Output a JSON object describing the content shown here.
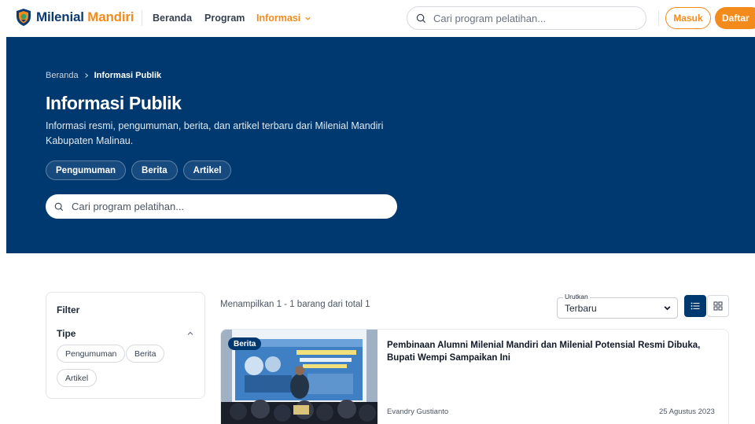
{
  "header": {
    "brand_part1": "Milenial",
    "brand_part2": "Mandiri",
    "nav": [
      {
        "label": "Beranda"
      },
      {
        "label": "Program"
      },
      {
        "label": "Informasi"
      }
    ],
    "search_placeholder": "Cari program pelatihan...",
    "login_label": "Masuk",
    "register_label": "Daftar"
  },
  "hero": {
    "breadcrumb": [
      "Beranda",
      "Informasi Publik"
    ],
    "title": "Informasi Publik",
    "description": "Informasi resmi, pengumuman, berita, dan artikel terbaru dari Milenial Mandiri Kabupaten Malinau.",
    "chips": [
      "Pengumuman",
      "Berita",
      "Artikel"
    ],
    "search_placeholder": "Cari program pelatihan..."
  },
  "filter": {
    "title": "Filter",
    "type_label": "Tipe",
    "options": [
      "Pengumuman",
      "Berita",
      "Artikel"
    ]
  },
  "results": {
    "count_text": "Menampilkan 1 - 1 barang dari total 1",
    "sort_label": "Urutkan",
    "sort_value": "Terbaru",
    "articles": [
      {
        "badge": "Berita",
        "title": "Pembinaan Alumni Milenial Mandiri dan Milenial Potensial Resmi Dibuka, Bupati Wempi Sampaikan Ini",
        "author": "Evandry Gustianto",
        "date": "25 Agustus 2023"
      }
    ]
  },
  "colors": {
    "primary": "#00396f",
    "accent": "#f28b1c"
  },
  "icons": {
    "logo": "shield-logo-icon",
    "search": "search-icon",
    "chevron_down": "chevron-down-icon",
    "chevron_up": "chevron-up-icon",
    "breadcrumb_separator": "chevron-right-icon",
    "view_list": "list-view-icon",
    "view_grid": "grid-view-icon"
  }
}
